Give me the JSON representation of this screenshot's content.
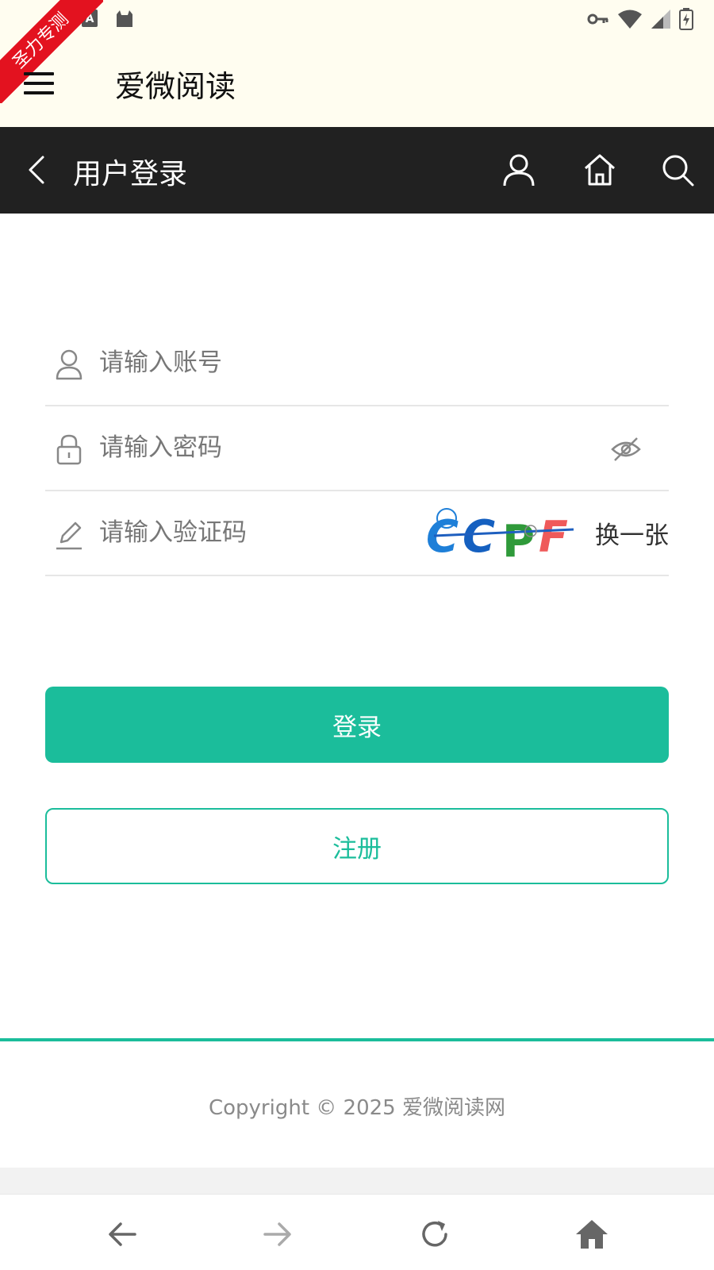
{
  "status_bar": {
    "left_icons": [
      "circle-icon",
      "font-a-icon",
      "cat-icon"
    ],
    "right_icons": [
      "key-icon",
      "wifi-icon",
      "signal-icon",
      "battery-charging-icon"
    ]
  },
  "ribbon": {
    "text": "圣力专测"
  },
  "app_header": {
    "title": "爱微阅读"
  },
  "nav_bar": {
    "title": "用户登录"
  },
  "form": {
    "account_placeholder": "请输入账号",
    "password_placeholder": "请输入密码",
    "captcha_placeholder": "请输入验证码",
    "captcha_text": "CCPF",
    "refresh_label": "换一张"
  },
  "buttons": {
    "login": "登录",
    "register": "注册"
  },
  "footer": {
    "copyright": "Copyright © 2025 爱微阅读网"
  },
  "colors": {
    "accent": "#1bbd9b",
    "nav_bg": "#212121",
    "header_bg": "#fffdf0",
    "ribbon": "#e3121f"
  }
}
